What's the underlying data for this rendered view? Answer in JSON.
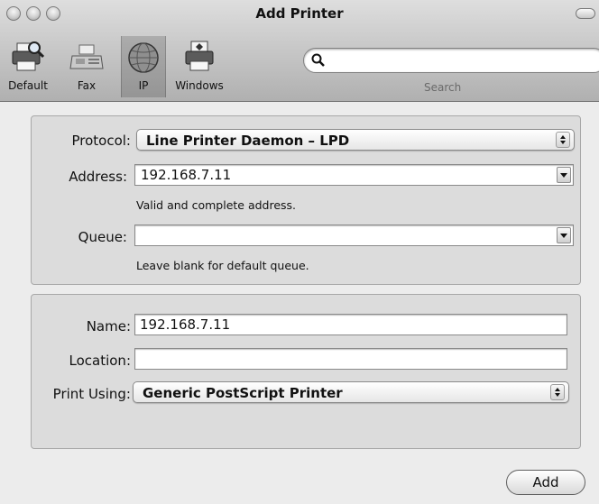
{
  "window": {
    "title": "Add Printer"
  },
  "toolbar": {
    "items": [
      {
        "label": "Default",
        "icon": "printer-default-icon",
        "selected": false
      },
      {
        "label": "Fax",
        "icon": "fax-icon",
        "selected": false
      },
      {
        "label": "IP",
        "icon": "globe-icon",
        "selected": true
      },
      {
        "label": "Windows",
        "icon": "windows-printer-icon",
        "selected": false
      }
    ],
    "search": {
      "value": "",
      "placeholder": "",
      "label": "Search"
    }
  },
  "connection": {
    "protocol_label": "Protocol:",
    "protocol_value": "Line Printer Daemon – LPD",
    "address_label": "Address:",
    "address_value": "192.168.7.11",
    "address_hint": "Valid and complete address.",
    "queue_label": "Queue:",
    "queue_value": "",
    "queue_hint": "Leave blank for default queue."
  },
  "printer": {
    "name_label": "Name:",
    "name_value": "192.168.7.11",
    "location_label": "Location:",
    "location_value": "",
    "print_using_label": "Print Using:",
    "print_using_value": "Generic PostScript Printer"
  },
  "buttons": {
    "add_label": "Add"
  }
}
